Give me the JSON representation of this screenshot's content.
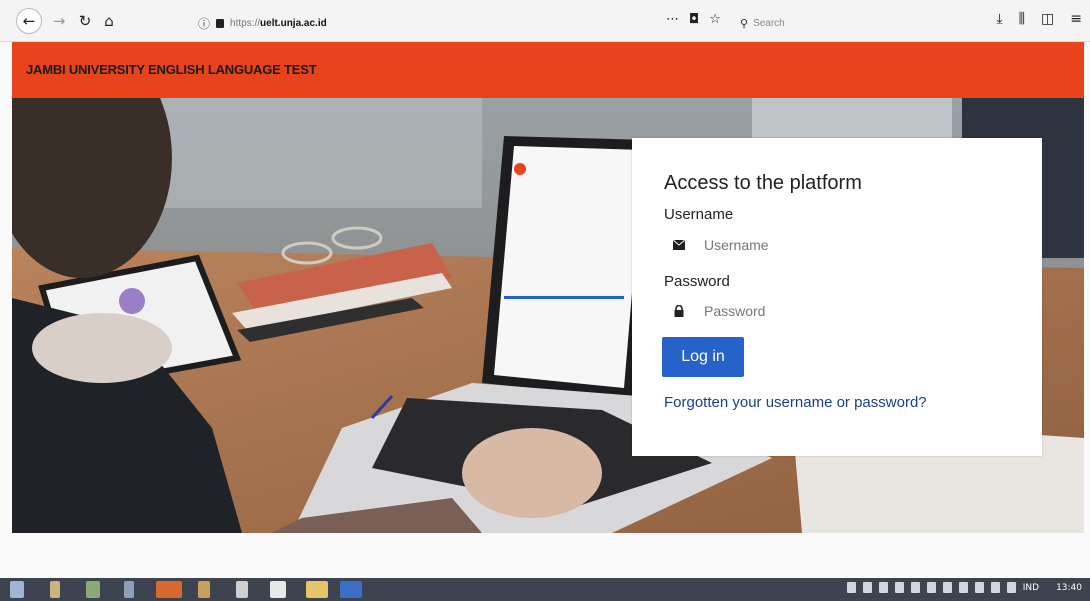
{
  "browser": {
    "url_scheme": "https://",
    "url_host": "uelt.unja.ac.id",
    "search_placeholder": "Search",
    "icons": [
      "back-arrow",
      "forward-arrow",
      "reload",
      "home",
      "info",
      "lock",
      "more",
      "pocket",
      "bookmark-star",
      "download",
      "library",
      "sidebar",
      "menu"
    ]
  },
  "header": {
    "title": "JAMBI UNIVERSITY ENGLISH LANGUAGE TEST",
    "color": "#e8441c"
  },
  "login": {
    "title": "Access to the platform",
    "username_label": "Username",
    "username_placeholder": "Username",
    "password_label": "Password",
    "password_placeholder": "Password",
    "submit_label": "Log in",
    "forgot_link": "Forgotten your username or password?",
    "button_color": "#2562c9"
  },
  "taskbar": {
    "lang": "IND",
    "time": "13:40"
  }
}
